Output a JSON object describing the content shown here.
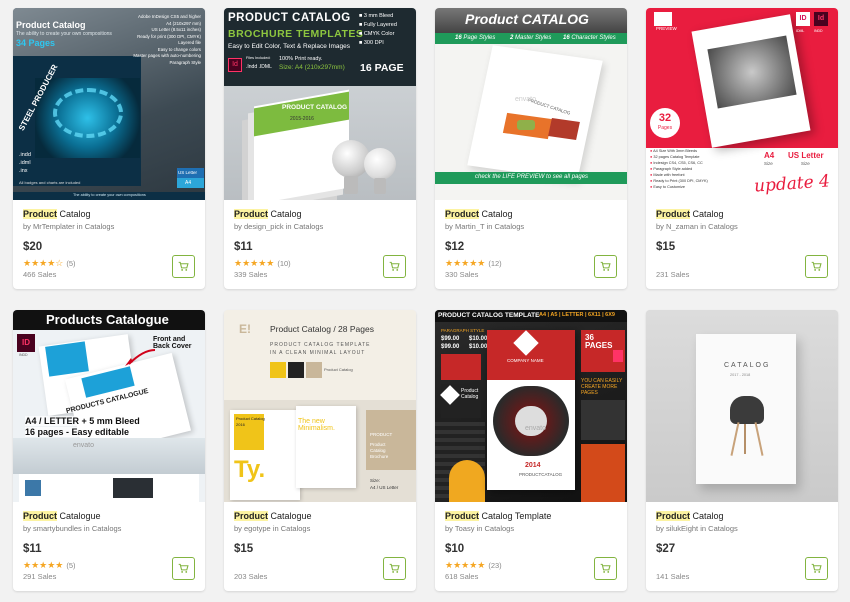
{
  "items": [
    {
      "title_highlight": "Product",
      "title_rest": " Catalog",
      "author": "MrTemplater",
      "category": "Catalogs",
      "price": "$20",
      "stars": "★★★★☆",
      "rating_count": "(5)",
      "sales": "466 Sales",
      "thumb": {
        "title": "Product Catalog",
        "tagline": "The ability to create your own compositions",
        "pages": "34 Pages",
        "features": [
          "Adobe InDesign CS5 and higher",
          "A4 (210x297 mm)",
          "US Letter (8.5x11 inches)",
          "Ready for print (300 DPI, CMYK)",
          "Layered file",
          "Easy to change colors",
          "Master pages with auto-numbering",
          "Paragraph Style"
        ],
        "cover": "STEEL PRODUCER",
        "files": [
          ".indd",
          ".idml",
          ".inx"
        ],
        "note": "All badges and charts are included",
        "badge1": "US Letter",
        "badge2": "A4",
        "footer": "The ability to create your own compositions"
      }
    },
    {
      "title_highlight": "Product",
      "title_rest": " Catalog",
      "author": "design_pick",
      "category": "Catalogs",
      "price": "$11",
      "stars": "★★★★★",
      "rating_count": "(10)",
      "sales": "339 Sales",
      "thumb": {
        "line1": "PRODUCT CATALOG",
        "line2": "BROCHURE TEMPLATES",
        "line3": "Easy to Edit Color, Text & Replace Images",
        "features": [
          "3 mm Bleed",
          "Fully Layered",
          "CMYK Color",
          "300 DPI"
        ],
        "files_label": "Files Included:",
        "files": ".Indd .IDML",
        "print": "100% Print ready.",
        "size": "Size: A4 (210x297mm)",
        "pages": "16 PAGE",
        "cover_title": "PRODUCT CATALOG",
        "cover_year": "2015-2016"
      }
    },
    {
      "title_highlight": "Product",
      "title_rest": " Catalog",
      "author": "Martin_T",
      "category": "Catalogs",
      "price": "$12",
      "stars": "★★★★★",
      "rating_count": "(12)",
      "sales": "330 Sales",
      "thumb": {
        "header": "Product CATALOG",
        "bar1": "16",
        "bar1_label": "Page Styles",
        "bar2": "2",
        "bar2_label": "Master Styles",
        "bar3": "16",
        "bar3_label": "Character Styles",
        "watermark": "envato",
        "cover": "PRODUCT CATALOG",
        "footer": "check the LIFE PREVIEW to see all pages"
      }
    },
    {
      "title_highlight": "Product",
      "title_rest": " Catalog",
      "author": "N_zaman",
      "category": "Catalogs",
      "price": "$15",
      "stars": "",
      "rating_count": "",
      "sales": "231 Sales",
      "thumb": {
        "preview": "PREVIEW",
        "ids": [
          "ID",
          "IDML",
          "INDD"
        ],
        "pages_num": "32",
        "pages_label": "Pages",
        "features": [
          "A4 Size With 3mm Bleeds",
          "32 pages Catalog Template",
          "Indesign CS4, CS5, CS6, CC",
          "Paragraph Style added",
          "Made with freefont",
          "Ready to Print (300 DPI, CMYK)",
          "Easy to Customize"
        ],
        "size_a4": "A4",
        "size_a4_sub": "Size",
        "size_us": "US Letter",
        "size_us_sub": "Size",
        "handwrite": "update 4"
      }
    },
    {
      "title_highlight": "Product",
      "title_rest": " Catalogue",
      "author": "smartybundles",
      "category": "Catalogs",
      "price": "$11",
      "stars": "★★★★★",
      "rating_count": "(5)",
      "sales": "291 Sales",
      "thumb": {
        "header": "Products Catalogue",
        "annot": "Front and Back Cover",
        "brochure": "PRODUCTS CATALOGUE",
        "line1": "A4 / LETTER + 5 mm Bleed",
        "line2": "16 pages - Easy editable",
        "watermark": "envato",
        "id": "ID",
        "indd": "INDD"
      }
    },
    {
      "title_highlight": "Product",
      "title_rest": " Catalogue",
      "author": "egotype",
      "category": "Catalogs",
      "price": "$15",
      "stars": "",
      "rating_count": "",
      "sales": "203 Sales",
      "thumb": {
        "logo": "E!",
        "title": "Product Catalog / 28 Pages",
        "sub1": "PRODUCT CATALOG TEMPLATE",
        "sub2": "IN A CLEAN MINIMAL LAYOUT",
        "swatch_label": "Product Catalog",
        "new": "The new Minimalism.",
        "side1": "PRODUCT",
        "side2": "Product",
        "side3": "Catalog",
        "side4": "Brochure",
        "size_label": "Size:",
        "size": "A4 / US Letter",
        "ty": "Ty.",
        "cover_title": "Product Catalog",
        "cover_year": "2016"
      }
    },
    {
      "title_highlight": "Product",
      "title_rest": " Catalog Template",
      "author": "Toasy",
      "category": "Catalogs",
      "price": "$10",
      "stars": "★★★★★",
      "rating_count": "(23)",
      "sales": "618 Sales",
      "thumb": {
        "header": "PRODUCT CATALOG TEMPLATE",
        "header_sizes": "A4 | A5 | LETTER | 6X11 | 6X9",
        "pages": "36 PAGES",
        "company": "COMPANY NAME",
        "logo_label": "Product Catalog",
        "year": "2014",
        "year_label": "PRODUCTCATALOG",
        "prices": [
          "$99.00",
          "$10.00",
          "$99.00",
          "$10.00"
        ],
        "style_label": "PARAGRAPH STYLE",
        "easy": "YOU CAN EASILY CREATE MORE PAGES",
        "watermark": "envato"
      }
    },
    {
      "title_highlight": "Product",
      "title_rest": " Catalog",
      "author": "silukEight",
      "category": "Catalogs",
      "price": "$27",
      "stars": "",
      "rating_count": "",
      "sales": "141 Sales",
      "thumb": {
        "cover_title": "CATALOG",
        "cover_year": "2017 - 2018"
      }
    }
  ],
  "labels": {
    "by": "by",
    "in": "in"
  },
  "colors": {
    "accent_green": "#82b440",
    "star": "#f5a623",
    "highlight": "#fcf3a1"
  },
  "icons": {
    "cart": "cart-icon"
  }
}
